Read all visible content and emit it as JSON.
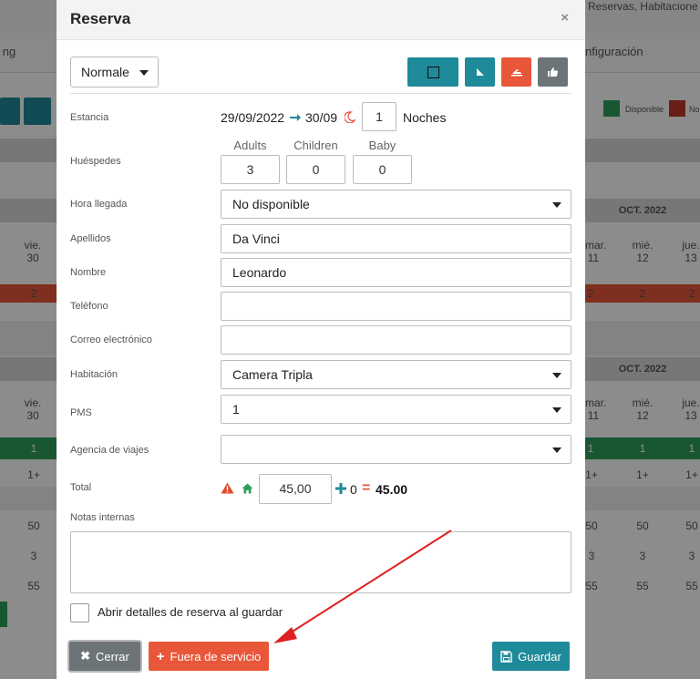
{
  "background": {
    "top_right_text": "Reservas, Habitacione",
    "nav_left": "ng",
    "nav_right": "nfiguración",
    "legend_available": "Disponible",
    "legend_no": "No",
    "month_label_1": "OCT. 2022",
    "month_label_2": "OCT. 2022",
    "left_days": [
      {
        "dow": "vie.",
        "day": "30"
      },
      {
        "dow": "vie.",
        "day": "30"
      }
    ],
    "right_days": [
      {
        "dow": "mar.",
        "day": "11"
      },
      {
        "dow": "mié.",
        "day": "12"
      },
      {
        "dow": "jue.",
        "day": "13"
      }
    ],
    "row_values": {
      "red_cell": "2",
      "green_cell": "1",
      "row_1plus": "1+",
      "row_50": "50",
      "row_3": "3",
      "row_55": "55"
    }
  },
  "modal": {
    "title": "Reserva",
    "close_symbol": "×",
    "type_select": "Normale",
    "header_buttons": [
      {
        "icon": "square-icon",
        "color": "#1f8a99"
      },
      {
        "icon": "flag-corner-icon",
        "color": "#1f8a99"
      },
      {
        "icon": "plane-icon",
        "color": "#e8573a"
      },
      {
        "icon": "thumbs-up-icon",
        "color": "#6d7478"
      }
    ],
    "stay": {
      "label": "Estancia",
      "checkin": "29/09/2022",
      "checkout": "30/09",
      "nights": "1",
      "nights_label": "Noches"
    },
    "guests": {
      "label": "Huéspedes",
      "adults_label": "Adults",
      "children_label": "Children",
      "baby_label": "Baby",
      "adults": "3",
      "children": "0",
      "baby": "0"
    },
    "arrival": {
      "label": "Hora llegada",
      "value": "No disponible"
    },
    "surname": {
      "label": "Apellidos",
      "value": "Da Vinci"
    },
    "name": {
      "label": "Nombre",
      "value": "Leonardo"
    },
    "phone": {
      "label": "Teléfono",
      "value": ""
    },
    "email": {
      "label": "Correo electrónico",
      "value": ""
    },
    "room": {
      "label": "Habitación",
      "value": "Camera Tripla"
    },
    "pms": {
      "label": "PMS",
      "value": "1"
    },
    "agency": {
      "label": "Agencia de viajes",
      "value": ""
    },
    "total": {
      "label": "Total",
      "price": "45,00",
      "extra": "0",
      "result": "45.00"
    },
    "notes": {
      "label": "Notas internas",
      "value": ""
    },
    "open_details_label": "Abrir detalles de reserva al guardar",
    "buttons": {
      "close": "Cerrar",
      "out_of_service": "Fuera de servicio",
      "save": "Guardar"
    },
    "colors": {
      "teal": "#1f8a99",
      "orange": "#e8573a",
      "grey": "#6d7478",
      "annotation_red": "#e02020"
    }
  }
}
